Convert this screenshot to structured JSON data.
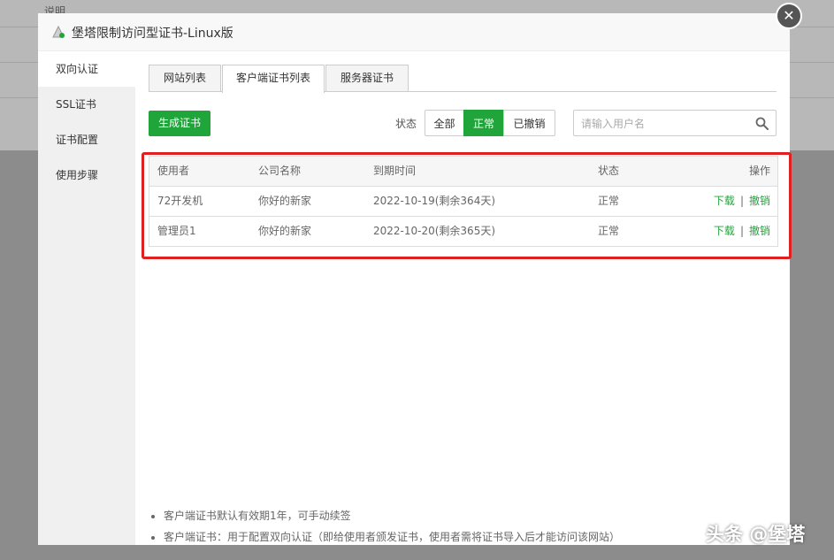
{
  "background": {
    "partial_text": "说明"
  },
  "modal": {
    "title": "堡塔限制访问型证书-Linux版",
    "close_symbol": "✕"
  },
  "sidebar": {
    "items": [
      {
        "label": "双向认证",
        "active": true
      },
      {
        "label": "SSL证书",
        "active": false
      },
      {
        "label": "证书配置",
        "active": false
      },
      {
        "label": "使用步骤",
        "active": false
      }
    ]
  },
  "tabs": [
    {
      "label": "网站列表",
      "active": false
    },
    {
      "label": "客户端证书列表",
      "active": true
    },
    {
      "label": "服务器证书",
      "active": false
    }
  ],
  "toolbar": {
    "generate_label": "生成证书",
    "status_label": "状态",
    "filters": [
      {
        "label": "全部",
        "active": false
      },
      {
        "label": "正常",
        "active": true
      },
      {
        "label": "已撤销",
        "active": false
      }
    ],
    "search_placeholder": "请输入用户名",
    "search_icon": "search-icon"
  },
  "table": {
    "headers": [
      "使用者",
      "公司名称",
      "到期时间",
      "状态",
      "操作"
    ],
    "rows": [
      {
        "user": "72开发机",
        "company": "你好的新家",
        "expiry": "2022-10-19(剩余364天)",
        "status": "正常",
        "download": "下载",
        "separator": "|",
        "revoke": "撤销"
      },
      {
        "user": "管理员1",
        "company": "你好的新家",
        "expiry": "2022-10-20(剩余365天)",
        "status": "正常",
        "download": "下载",
        "separator": "|",
        "revoke": "撤销"
      }
    ]
  },
  "notes": [
    "客户端证书默认有效期1年，可手动续签",
    "客户端证书：用于配置双向认证（即给使用者颁发证书，使用者需将证书导入后才能访问该网站）"
  ],
  "watermark": "头条 @堡塔",
  "colors": {
    "accent_green": "#20a53a",
    "highlight_red": "#e02020"
  }
}
